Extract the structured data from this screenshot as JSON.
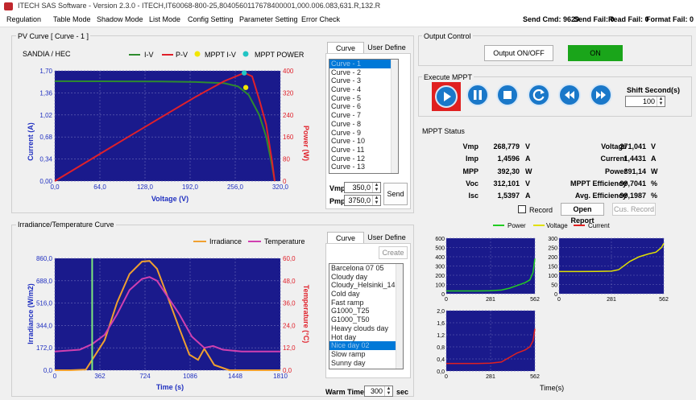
{
  "title": "ITECH SAS Software - Version 2.3.0 - ITECH,IT60068-800-25,8040560117678400001,000.006.083,631.R,132.R",
  "menu": [
    "Regulation",
    "Table Mode",
    "Shadow Mode",
    "List Mode",
    "Config Setting",
    "Parameter Setting",
    "Error Check"
  ],
  "status_bar": {
    "send_cmd": "Send Cmd: 9629",
    "send_fail": "Send Fail: 0",
    "read_fail": "Read Fail: 0",
    "format_fail": "Format Fail: 0"
  },
  "pv_panel": {
    "title": "PV Curve [ Curve - 1 ]",
    "subtitle": "SANDIA / HEC",
    "legend": [
      "I-V",
      "P-V",
      "MPPT I-V",
      "MPPT POWER"
    ],
    "y_left_label": "Current (A)",
    "y_right_label": "Power (W)",
    "x_label": "Voltage (V)",
    "y_left_ticks": [
      "1,70",
      "1,36",
      "1,02",
      "0,68",
      "0,34",
      "0,00"
    ],
    "y_right_ticks": [
      "400",
      "320",
      "240",
      "160",
      "80",
      "0"
    ],
    "x_ticks": [
      "0,0",
      "64,0",
      "128,0",
      "192,0",
      "256,0",
      "320,0"
    ]
  },
  "curve_tabs": {
    "curve": "Curve",
    "user_define": "User Define"
  },
  "curve_list": [
    "Curve - 1",
    "Curve - 2",
    "Curve - 3",
    "Curve - 4",
    "Curve - 5",
    "Curve - 6",
    "Curve - 7",
    "Curve - 8",
    "Curve - 9",
    "Curve - 10",
    "Curve - 11",
    "Curve - 12",
    "Curve - 13"
  ],
  "vmp": {
    "label": "Vmp",
    "value": "350,0"
  },
  "pmp": {
    "label": "Pmp",
    "value": "3750,0"
  },
  "send_button": "Send",
  "output_control": {
    "title": "Output Control",
    "button": "Output ON/OFF",
    "state": "ON"
  },
  "execute_mppt": {
    "title": "Execute MPPT",
    "shift_label": "Shift Second(s)",
    "shift_value": "100",
    "buttons": [
      "play-icon",
      "pause-icon",
      "stop-icon",
      "refresh-icon",
      "rewind-icon",
      "fast-forward-icon"
    ]
  },
  "mppt_status": {
    "title": "MPPT Status",
    "left": [
      {
        "label": "Vmp",
        "value": "268,779",
        "unit": "V"
      },
      {
        "label": "Imp",
        "value": "1,4596",
        "unit": "A"
      },
      {
        "label": "MPP",
        "value": "392,30",
        "unit": "W"
      },
      {
        "label": "Voc",
        "value": "312,101",
        "unit": "V"
      },
      {
        "label": "Isc",
        "value": "1,5397",
        "unit": "A"
      }
    ],
    "right": [
      {
        "label": "Voltage",
        "value": "271,041",
        "unit": "V"
      },
      {
        "label": "Current",
        "value": "1,4431",
        "unit": "A"
      },
      {
        "label": "Power",
        "value": "391,14",
        "unit": "W"
      },
      {
        "label": "MPPT Efficiency",
        "value": "99,7041",
        "unit": "%"
      },
      {
        "label": "Avg. Efficiency",
        "value": "99,1987",
        "unit": "%"
      }
    ],
    "record_label": "Record",
    "open_record": "Open Report",
    "cus_record": "Cus. Record"
  },
  "mini_legend": [
    "Power",
    "Voltage",
    "Current"
  ],
  "mini_charts": {
    "power": {
      "y_ticks": [
        "600",
        "500",
        "400",
        "300",
        "200",
        "100",
        "0"
      ],
      "x_ticks": [
        "0",
        "281",
        "562"
      ]
    },
    "voltage": {
      "y_ticks": [
        "300",
        "250",
        "200",
        "150",
        "100",
        "50",
        "0"
      ],
      "x_ticks": [
        "0",
        "281",
        "562"
      ]
    },
    "current": {
      "y_ticks": [
        "2,0",
        "1,6",
        "1,2",
        "0,8",
        "0,4",
        "0,0"
      ],
      "x_ticks": [
        "0",
        "281",
        "562"
      ]
    },
    "x_label": "Time(s)"
  },
  "irr_panel": {
    "title": "Irradiance/Temperature Curve",
    "legend": [
      "Irradiance",
      "Temperature"
    ],
    "y_left_label": "Irradiance (W/m2)",
    "y_right_label": "Temperature (°C)",
    "x_label": "Time (s)",
    "y_left_ticks": [
      "860,0",
      "688,0",
      "516,0",
      "344,0",
      "172,0",
      "0,0"
    ],
    "y_right_ticks": [
      "60,0",
      "48,0",
      "36,0",
      "24,0",
      "12,0",
      "0,0"
    ],
    "x_ticks": [
      "0",
      "362",
      "724",
      "1086",
      "1448",
      "1810"
    ]
  },
  "irr_tabs": {
    "curve": "Curve",
    "user_define": "User Define",
    "create": "Create"
  },
  "irr_list": [
    "Barcelona 07 05",
    "Cloudy day",
    "Cloudy_Helsinki_14",
    "Cold day",
    "Fast ramp",
    "G1000_T25",
    "G1000_T50",
    "Heavy clouds day",
    "Hot day",
    "Nice day 02",
    "Slow ramp",
    "Sunny day"
  ],
  "irr_selected": 9,
  "warm_time": {
    "label": "Warm Time",
    "value": "300",
    "unit": "sec"
  },
  "colors": {
    "plot_bg": "#1a1a8c",
    "iv": "#2e8b2e",
    "pv": "#e0202a",
    "mppt_iv": "#f2e600",
    "mppt_power": "#22c4c4",
    "irradiance": "#f0a030",
    "temperature": "#d040b0",
    "on_green": "#1aa51a"
  },
  "chart_data": [
    {
      "type": "line",
      "title": "PV Curve [ Curve - 1 ]",
      "xlabel": "Voltage (V)",
      "ylabel": "Current (A)",
      "y2label": "Power (W)",
      "xlim": [
        0,
        320
      ],
      "ylim": [
        0,
        1.7
      ],
      "y2lim": [
        0,
        400
      ],
      "series": [
        {
          "name": "I-V",
          "axis": "left",
          "x": [
            0,
            50,
            100,
            150,
            200,
            240,
            260,
            275,
            290,
            300,
            308,
            312
          ],
          "y": [
            1.5397,
            1.539,
            1.538,
            1.535,
            1.528,
            1.51,
            1.4596,
            1.33,
            1.02,
            0.68,
            0.25,
            0.0
          ]
        },
        {
          "name": "P-V",
          "axis": "right",
          "x": [
            0,
            50,
            100,
            150,
            200,
            240,
            268.8,
            280,
            290,
            300,
            308,
            312
          ],
          "y": [
            0,
            77,
            154,
            230,
            306,
            362,
            392.3,
            380,
            296,
            204,
            77,
            0
          ]
        },
        {
          "name": "MPPT I-V",
          "axis": "left",
          "x": [
            271.0
          ],
          "y": [
            1.4431
          ]
        },
        {
          "name": "MPPT POWER",
          "axis": "right",
          "x": [
            268.8
          ],
          "y": [
            392.3
          ]
        }
      ]
    },
    {
      "type": "line",
      "title": "Irradiance/Temperature Curve",
      "xlabel": "Time (s)",
      "ylabel": "Irradiance (W/m2)",
      "y2label": "Temperature (°C)",
      "xlim": [
        0,
        1810
      ],
      "ylim": [
        0,
        860
      ],
      "y2lim": [
        0,
        60
      ],
      "series": [
        {
          "name": "Irradiance",
          "axis": "left",
          "x": [
            0,
            130,
            250,
            400,
            500,
            600,
            700,
            760,
            820,
            900,
            1000,
            1080,
            1150,
            1200,
            1280,
            1400,
            1810
          ],
          "y": [
            0,
            0,
            5,
            230,
            520,
            740,
            835,
            840,
            780,
            580,
            320,
            120,
            80,
            165,
            40,
            0,
            0
          ]
        },
        {
          "name": "Temperature",
          "axis": "right",
          "x": [
            0,
            200,
            300,
            400,
            500,
            600,
            700,
            760,
            820,
            900,
            1000,
            1100,
            1200,
            1270,
            1350,
            1500,
            1810
          ],
          "y": [
            10,
            11,
            14,
            19,
            30,
            43,
            49,
            50,
            48,
            40,
            30,
            18,
            12,
            13,
            11,
            10,
            10
          ]
        }
      ]
    },
    {
      "type": "line",
      "title": "",
      "xlabel": "",
      "ylabel": "",
      "xlim": [
        0,
        562
      ],
      "ylim": [
        0,
        600
      ],
      "series": [
        {
          "name": "Power",
          "x": [
            0,
            100,
            200,
            281,
            350,
            400,
            450,
            500,
            530,
            550,
            562
          ],
          "y": [
            30,
            30,
            30,
            32,
            40,
            60,
            90,
            120,
            150,
            230,
            380
          ]
        }
      ]
    },
    {
      "type": "line",
      "title": "",
      "xlabel": "",
      "ylabel": "",
      "xlim": [
        0,
        562
      ],
      "ylim": [
        0,
        300
      ],
      "series": [
        {
          "name": "Voltage",
          "x": [
            0,
            100,
            200,
            281,
            320,
            380,
            430,
            480,
            520,
            550,
            562
          ],
          "y": [
            120,
            120,
            121,
            122,
            130,
            175,
            200,
            215,
            225,
            250,
            272
          ]
        }
      ]
    },
    {
      "type": "line",
      "title": "",
      "xlabel": "",
      "ylabel": "",
      "xlim": [
        0,
        562
      ],
      "ylim": [
        0,
        2.0
      ],
      "series": [
        {
          "name": "Current",
          "x": [
            0,
            100,
            200,
            281,
            350,
            400,
            450,
            500,
            530,
            550,
            562
          ],
          "y": [
            0.25,
            0.25,
            0.25,
            0.26,
            0.3,
            0.45,
            0.6,
            0.7,
            0.8,
            1.0,
            1.4
          ]
        }
      ]
    }
  ]
}
